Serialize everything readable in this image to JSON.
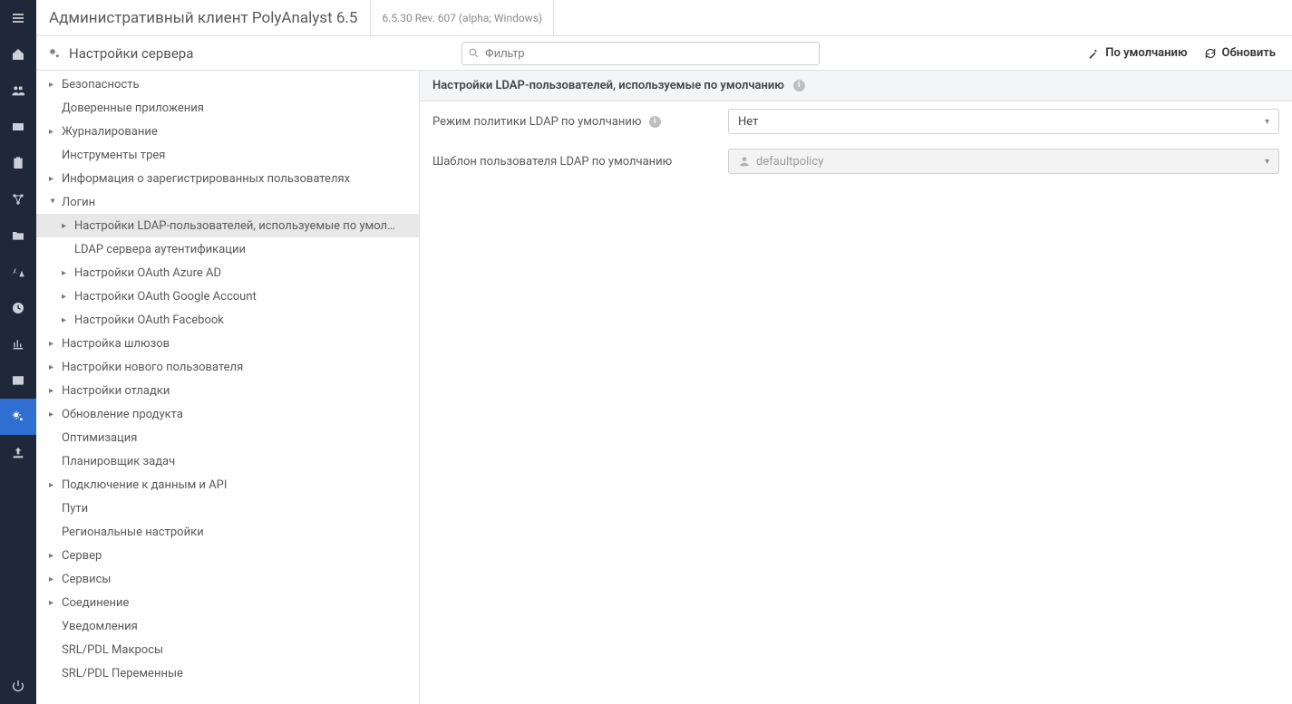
{
  "topbar": {
    "app_title": "Административный клиент PolyAnalyst 6.5",
    "version": "6.5.30 Rev. 607 (alpha; Windows)"
  },
  "leftbar": {
    "items": [
      {
        "name": "home-icon"
      },
      {
        "name": "users-icon"
      },
      {
        "name": "card-icon"
      },
      {
        "name": "clipboard-icon"
      },
      {
        "name": "nodes-icon"
      },
      {
        "name": "folder-icon"
      },
      {
        "name": "language-icon"
      },
      {
        "name": "clock-icon"
      },
      {
        "name": "chart-icon"
      },
      {
        "name": "window-icon"
      },
      {
        "name": "cogs-icon",
        "active": true
      },
      {
        "name": "upload-icon"
      }
    ],
    "power_name": "power-icon"
  },
  "toolbar": {
    "title": "Настройки сервера",
    "filter_placeholder": "Фильтр",
    "default_label": "По умолчанию",
    "refresh_label": "Обновить"
  },
  "tree": [
    {
      "label": "Безопасность",
      "level": 1,
      "caret": true
    },
    {
      "label": "Доверенные приложения",
      "level": 1,
      "caret": false
    },
    {
      "label": "Журналирование",
      "level": 1,
      "caret": true
    },
    {
      "label": "Инструменты трея",
      "level": 1,
      "caret": false
    },
    {
      "label": "Информация о зарегистрированных пользователях",
      "level": 1,
      "caret": true
    },
    {
      "label": "Логин",
      "level": 1,
      "caret": true,
      "expanded": true
    },
    {
      "label": "Настройки LDAP-пользователей, используемые по умол…",
      "level": 2,
      "caret": true,
      "selected": true
    },
    {
      "label": "LDAP сервера аутентификации",
      "level": 2,
      "caret": false
    },
    {
      "label": "Настройки OAuth Azure AD",
      "level": 2,
      "caret": true
    },
    {
      "label": "Настройки OAuth Google Account",
      "level": 2,
      "caret": true
    },
    {
      "label": "Настройки OAuth Facebook",
      "level": 2,
      "caret": true
    },
    {
      "label": "Настройка шлюзов",
      "level": 1,
      "caret": true
    },
    {
      "label": "Настройки нового пользователя",
      "level": 1,
      "caret": true
    },
    {
      "label": "Настройки отладки",
      "level": 1,
      "caret": true
    },
    {
      "label": "Обновление продукта",
      "level": 1,
      "caret": true
    },
    {
      "label": "Оптимизация",
      "level": 1,
      "caret": false
    },
    {
      "label": "Планировщик задач",
      "level": 1,
      "caret": false
    },
    {
      "label": "Подключение к данным и API",
      "level": 1,
      "caret": true
    },
    {
      "label": "Пути",
      "level": 1,
      "caret": false
    },
    {
      "label": "Региональные настройки",
      "level": 1,
      "caret": false
    },
    {
      "label": "Сервер",
      "level": 1,
      "caret": true
    },
    {
      "label": "Сервисы",
      "level": 1,
      "caret": true
    },
    {
      "label": "Соединение",
      "level": 1,
      "caret": true
    },
    {
      "label": "Уведомления",
      "level": 1,
      "caret": false
    },
    {
      "label": "SRL/PDL Макросы",
      "level": 1,
      "caret": false
    },
    {
      "label": "SRL/PDL Переменные",
      "level": 1,
      "caret": false
    }
  ],
  "detail": {
    "header": "Настройки LDAP-пользователей, используемые по умолчанию",
    "rows": [
      {
        "label": "Режим политики LDAP по умолчанию",
        "info": true,
        "value": "Нет",
        "dim": false,
        "icon": false
      },
      {
        "label": "Шаблон пользователя LDAP по умолчанию",
        "info": false,
        "value": "defaultpolicy",
        "dim": true,
        "icon": true
      }
    ]
  }
}
